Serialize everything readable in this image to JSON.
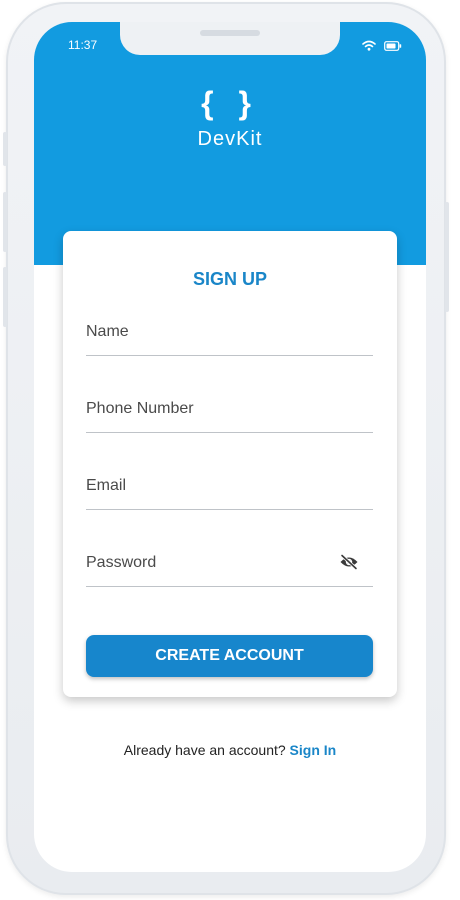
{
  "status_bar": {
    "time": "11:37",
    "wifi_icon": "wifi-icon",
    "battery_icon": "battery-icon"
  },
  "brand": {
    "logo_glyph": "{ }",
    "name": "DevKit"
  },
  "form": {
    "title": "SIGN UP",
    "fields": [
      {
        "label": "Name"
      },
      {
        "label": "Phone Number"
      },
      {
        "label": "Email"
      },
      {
        "label": "Password",
        "trailing_icon": "eye-off-icon"
      }
    ],
    "submit_label": "CREATE ACCOUNT"
  },
  "footer": {
    "prompt": "Already have an account?",
    "link": "Sign In"
  },
  "colors": {
    "brand_blue": "#129be0",
    "accent_blue": "#1a86c8",
    "button_blue": "#1786cc"
  }
}
